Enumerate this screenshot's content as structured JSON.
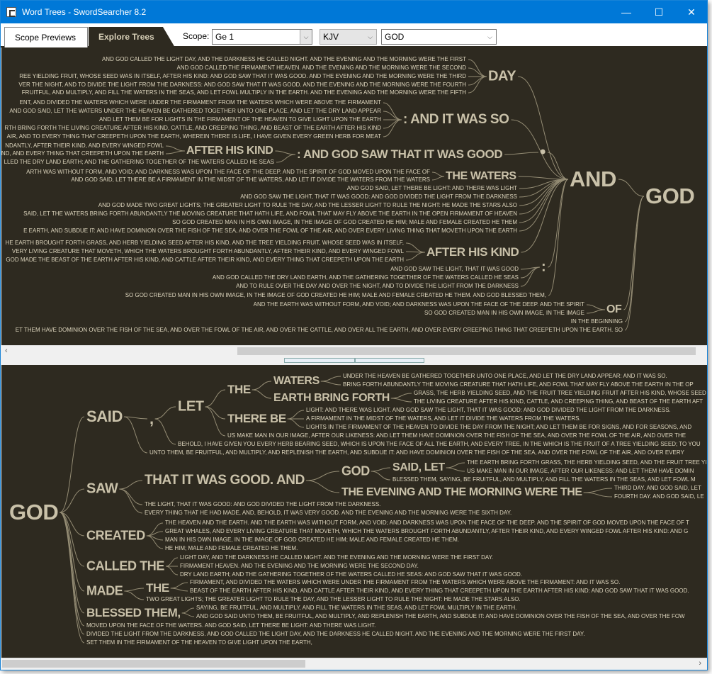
{
  "window": {
    "title": "Word Trees - SwordSearcher 8.2",
    "minimize": "—",
    "maximize": "☐",
    "close": "✕"
  },
  "tabs": [
    {
      "label": "Scope Previews"
    },
    {
      "label": "Explore Trees"
    }
  ],
  "toolbar": {
    "scope_label": "Scope:",
    "scope_value": "Ge 1",
    "version_value": "KJV",
    "word_value": "GOD",
    "dropdown_icon": "⌵"
  },
  "colors": {
    "titlebar": "#0078d7",
    "tree_bg": "#2e2a20",
    "leaf_text": "#ddd5bd",
    "node_text": "#c9c1a9",
    "connector": "#948c74"
  },
  "top_tree": {
    "nodes": {
      "day": "DAY",
      "so": ": AND IT WAS SO",
      "ahk1": "AFTER HIS KIND",
      "good": ": AND GOD SAW THAT IT WAS GOOD",
      "dot": "•",
      "waters": "THE WATERS",
      "and": "AND",
      "god": "GOD",
      "ahk2": "AFTER HIS KIND",
      "colon": ":",
      "of": "OF"
    },
    "leaves": [
      "AND GOD CALLED THE LIGHT DAY, AND THE DARKNESS HE CALLED NIGHT. AND THE EVENING AND THE MORNING WERE THE FIRST",
      "AND GOD CALLED THE FIRMAMENT HEAVEN. AND THE EVENING AND THE MORNING WERE THE SECOND",
      "REE YIELDING FRUIT, WHOSE SEED WAS IN ITSELF, AFTER HIS KIND: AND GOD SAW THAT IT WAS GOOD. AND THE EVENING AND THE MORNING WERE THE THIRD",
      "VER THE NIGHT, AND TO DIVIDE THE LIGHT FROM THE DARKNESS: AND GOD SAW THAT IT WAS GOOD. AND THE EVENING AND THE MORNING WERE THE FOURTH",
      "FRUITFUL, AND MULTIPLY, AND FILL THE WATERS IN THE SEAS, AND LET FOWL MULTIPLY IN THE EARTH. AND THE EVENING AND THE MORNING WERE THE FIFTH",
      "ENT, AND DIVIDED THE WATERS WHICH WERE UNDER THE FIRMAMENT FROM THE WATERS WHICH WERE ABOVE THE FIRMAMENT",
      "AND GOD SAID, LET THE WATERS UNDER THE HEAVEN BE GATHERED TOGETHER UNTO ONE PLACE, AND LET THE DRY LAND APPEAR",
      "AND LET THEM BE FOR LIGHTS IN THE FIRMAMENT OF THE HEAVEN TO GIVE LIGHT UPON THE EARTH",
      "RTH BRING FORTH THE LIVING CREATURE AFTER HIS KIND, CATTLE, AND CREEPING THING, AND BEAST OF THE EARTH AFTER HIS KIND",
      "AIR, AND TO EVERY THING THAT CREEPETH UPON THE EARTH, WHEREIN THERE IS LIFE, I HAVE GIVEN EVERY GREEN HERB FOR MEAT",
      "NDANTLY, AFTER THEIR KIND, AND EVERY WINGED FOWL",
      "ND, AND EVERY THING THAT CREEPETH UPON THE EARTH",
      "LLED THE DRY LAND EARTH; AND THE GATHERING TOGETHER OF THE WATERS CALLED HE SEAS",
      "ARTH WAS WITHOUT FORM, AND VOID; AND DARKNESS WAS UPON THE FACE OF THE DEEP. AND THE SPIRIT OF GOD MOVED UPON THE FACE OF",
      "AND GOD SAID, LET THERE BE A FIRMAMENT IN THE MIDST OF THE WATERS, AND LET IT DIVIDE THE WATERS FROM THE WATERS",
      "AND GOD SAID, LET THERE BE LIGHT: AND THERE WAS LIGHT",
      "AND GOD SAW THE LIGHT, THAT IT WAS GOOD: AND GOD DIVIDED THE LIGHT FROM THE DARKNESS",
      "AND GOD MADE TWO GREAT LIGHTS; THE GREATER LIGHT TO RULE THE DAY, AND THE LESSER LIGHT TO RULE THE NIGHT: HE MADE THE STARS ALSO",
      "SAID, LET THE WATERS BRING FORTH ABUNDANTLY THE MOVING CREATURE THAT HATH LIFE, AND FOWL THAT MAY FLY ABOVE THE EARTH IN THE OPEN FIRMAMENT OF HEAVEN",
      "SO GOD CREATED MAN IN HIS OWN IMAGE, IN THE IMAGE OF GOD CREATED HE HIM; MALE AND FEMALE CREATED HE THEM",
      "E EARTH, AND SUBDUE IT: AND HAVE DOMINION OVER THE FISH OF THE SEA, AND OVER THE FOWL OF THE AIR, AND OVER EVERY LIVING THING THAT MOVETH UPON THE EARTH",
      "HE EARTH BROUGHT FORTH GRASS, AND HERB YIELDING SEED AFTER HIS KIND, AND THE TREE YIELDING FRUIT, WHOSE SEED WAS IN ITSELF,",
      "VERY LIVING CREATURE THAT MOVETH, WHICH THE WATERS BROUGHT FORTH ABUNDANTLY, AFTER THEIR KIND, AND EVERY WINGED FOWL",
      "GOD MADE THE BEAST OF THE EARTH AFTER HIS KIND, AND CATTLE AFTER THEIR KIND, AND EVERY THING THAT CREEPETH UPON THE EARTH",
      "AND GOD SAW THE LIGHT, THAT IT WAS GOOD",
      "AND GOD CALLED THE DRY LAND EARTH, AND THE GATHERING TOGETHER OF THE WATERS CALLED HE SEAS",
      "AND TO RULE OVER THE DAY AND OVER THE NIGHT, AND TO DIVIDE THE LIGHT FROM THE DARKNESS",
      "SO GOD CREATED MAN IN HIS OWN IMAGE, IN THE IMAGE OF GOD CREATED HE HIM; MALE AND FEMALE CREATED HE THEM. AND GOD BLESSED THEM,",
      "AND THE EARTH WAS WITHOUT FORM, AND VOID; AND DARKNESS WAS UPON THE FACE OF THE DEEP. AND THE SPIRIT",
      "SO GOD CREATED MAN IN HIS OWN IMAGE, IN THE IMAGE",
      "IN THE BEGINNING",
      "ET THEM HAVE DOMINION OVER THE FISH OF THE SEA, AND OVER THE FOWL OF THE AIR, AND OVER THE CATTLE, AND OVER ALL THE EARTH, AND OVER EVERY CREEPING THING THAT CREEPETH UPON THE EARTH. SO"
    ]
  },
  "bottom_tree": {
    "nodes": {
      "god2": "GOD",
      "said": "SAID",
      "comma": ",",
      "let": "LET",
      "the1": "THE",
      "waters2": "WATERS",
      "ebf": "EARTH BRING FORTH",
      "therebe": "THERE BE",
      "saw": "SAW",
      "tiwg": "THAT IT WAS GOOD. AND",
      "god3": "GOD",
      "saidlet": "SAID, LET",
      "evening": "THE EVENING AND THE MORNING WERE THE",
      "created": "CREATED",
      "calledthe": "CALLED THE",
      "made": "MADE",
      "the2": "THE",
      "blessed": "BLESSED THEM,"
    },
    "leaves": [
      "UNDER THE HEAVEN BE GATHERED TOGETHER UNTO ONE PLACE, AND LET THE DRY LAND APPEAR: AND IT WAS SO.",
      "BRING FORTH ABUNDANTLY THE MOVING CREATURE THAT HATH LIFE, AND FOWL THAT MAY FLY ABOVE THE EARTH IN THE OP",
      "GRASS, THE HERB YIELDING SEED, AND THE FRUIT TREE YIELDING FRUIT AFTER HIS KIND, WHOSE SEED",
      "THE LIVING CREATURE AFTER HIS KIND, CATTLE, AND CREEPING THING, AND BEAST OF THE EARTH AFT",
      "LIGHT: AND THERE WAS LIGHT. AND GOD SAW THE LIGHT, THAT IT WAS GOOD: AND GOD DIVIDED THE LIGHT FROM THE DARKNESS.",
      "A FIRMAMENT IN THE MIDST OF THE WATERS, AND LET IT DIVIDE THE WATERS FROM THE WATERS.",
      "LIGHTS IN THE FIRMAMENT OF THE HEAVEN TO DIVIDE THE DAY FROM THE NIGHT; AND LET THEM BE FOR SIGNS, AND FOR SEASONS, AND",
      "US MAKE MAN IN OUR IMAGE, AFTER OUR LIKENESS: AND LET THEM HAVE DOMINION OVER THE FISH OF THE SEA, AND OVER THE FOWL OF THE AIR, AND OVER THE",
      "BEHOLD, I HAVE GIVEN YOU EVERY HERB BEARING SEED, WHICH IS UPON THE FACE OF ALL THE EARTH, AND EVERY TREE, IN THE WHICH IS THE FRUIT OF A TREE YIELDING SEED; TO YOU",
      "UNTO THEM, BE FRUITFUL, AND MULTIPLY, AND REPLENISH THE EARTH, AND SUBDUE IT: AND HAVE DOMINION OVER THE FISH OF THE SEA, AND OVER THE FOWL OF THE AIR, AND OVER EVERY",
      "THE EARTH BRING FORTH GRASS, THE HERB YIELDING SEED, AND THE FRUIT TREE YI",
      "US MAKE MAN IN OUR IMAGE, AFTER OUR LIKENESS: AND LET THEM HAVE DOMIN",
      "BLESSED THEM, SAYING, BE FRUITFUL, AND MULTIPLY, AND FILL THE WATERS IN THE SEAS, AND LET FOWL M",
      "THIRD DAY. AND GOD SAID, LET",
      "FOURTH DAY. AND GOD SAID, LE",
      "THE LIGHT, THAT IT WAS GOOD: AND GOD DIVIDED THE LIGHT FROM THE DARKNESS.",
      "EVERY THING THAT HE HAD MADE, AND, BEHOLD, IT WAS VERY GOOD. AND THE EVENING AND THE MORNING WERE THE SIXTH DAY.",
      "THE HEAVEN AND THE EARTH. AND THE EARTH WAS WITHOUT FORM, AND VOID; AND DARKNESS WAS UPON THE FACE OF THE DEEP. AND THE SPIRIT OF GOD MOVED UPON THE FACE OF T",
      "GREAT WHALES, AND EVERY LIVING CREATURE THAT MOVETH, WHICH THE WATERS BROUGHT FORTH ABUNDANTLY, AFTER THEIR KIND, AND EVERY WINGED FOWL AFTER HIS KIND: AND G",
      "MAN IN HIS OWN IMAGE, IN THE IMAGE OF GOD CREATED HE HIM; MALE AND FEMALE CREATED HE THEM.",
      "HE HIM; MALE AND FEMALE CREATED HE THEM.",
      "LIGHT DAY, AND THE DARKNESS HE CALLED NIGHT. AND THE EVENING AND THE MORNING WERE THE FIRST DAY.",
      "FIRMAMENT HEAVEN. AND THE EVENING AND THE MORNING WERE THE SECOND DAY.",
      "DRY LAND EARTH; AND THE GATHERING TOGETHER OF THE WATERS CALLED HE SEAS: AND GOD SAW THAT IT WAS GOOD.",
      "FIRMAMENT, AND DIVIDED THE WATERS WHICH WERE UNDER THE FIRMAMENT FROM THE WATERS WHICH WERE ABOVE THE FIRMAMENT: AND IT WAS SO.",
      "BEAST OF THE EARTH AFTER HIS KIND, AND CATTLE AFTER THEIR KIND, AND EVERY THING THAT CREEPETH UPON THE EARTH AFTER HIS KIND: AND GOD SAW THAT IT WAS GOOD.",
      "TWO GREAT LIGHTS; THE GREATER LIGHT TO RULE THE DAY, AND THE LESSER LIGHT TO RULE THE NIGHT: HE MADE THE STARS ALSO.",
      "SAYING, BE FRUITFUL, AND MULTIPLY, AND FILL THE WATERS IN THE SEAS, AND LET FOWL MULTIPLY IN THE EARTH.",
      "AND GOD SAID UNTO THEM, BE FRUITFUL, AND MULTIPLY, AND REPLENISH THE EARTH, AND SUBDUE IT: AND HAVE DOMINION OVER THE FISH OF THE SEA, AND OVER THE FOW",
      "MOVED UPON THE FACE OF THE WATERS. AND GOD SAID, LET THERE BE LIGHT: AND THERE WAS LIGHT.",
      "DIVIDED THE LIGHT FROM THE DARKNESS. AND GOD CALLED THE LIGHT DAY, AND THE DARKNESS HE CALLED NIGHT. AND THE EVENING AND THE MORNING WERE THE FIRST DAY.",
      "SET THEM IN THE FIRMAMENT OF THE HEAVEN TO GIVE LIGHT UPON THE EARTH,"
    ]
  },
  "scrollbars": {
    "left_arrow": "‹",
    "right_arrow": "›",
    "top_thumb_fraction": 0.65,
    "bottom_thumb_fraction": 0.43
  },
  "splitter": {
    "grip": "▲ ▼"
  }
}
